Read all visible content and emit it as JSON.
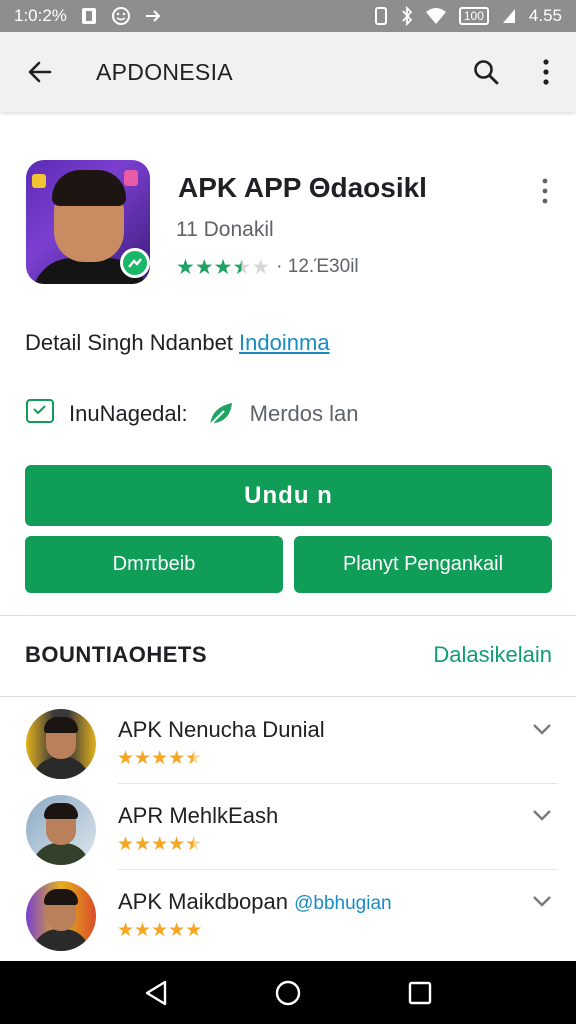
{
  "status_bar": {
    "time": "1:0:2%",
    "battery": "4.55",
    "battery_box": "100"
  },
  "app_bar": {
    "title": "APDONESIA"
  },
  "app": {
    "name": "APK APP Θdaosikl",
    "developer": "11 Donakil",
    "rating_count": "· 12.Έ30il",
    "stars": 3.5
  },
  "details": {
    "prefix": "Detail Singh Ndanbet",
    "link": "Indoinma"
  },
  "info": {
    "label": "InuNagedal:",
    "value": "Merdos lan"
  },
  "buttons": {
    "primary": "Undu n",
    "left": "Dmπbeib",
    "right": "Planyt Pengankail"
  },
  "section": {
    "title": "BOUNTIAOHETS",
    "link": "Dalasikelain"
  },
  "list": [
    {
      "name": "APK Nenucha Dunial",
      "handle": "",
      "stars": 4.5
    },
    {
      "name": "APR MehlkEash",
      "handle": "",
      "stars": 4.5
    },
    {
      "name": "APK Maikdbopan",
      "handle": "@bbhugian",
      "stars": 5
    }
  ],
  "colors": {
    "accent_green": "#0f9d58",
    "star_green": "#1ea362",
    "star_orange": "#f5a623",
    "link_blue": "#1a8cc2"
  },
  "icons": {
    "back": "arrow-left-icon",
    "search": "search-icon",
    "menu": "more-vert-icon",
    "chevron": "chevron-down-icon"
  }
}
